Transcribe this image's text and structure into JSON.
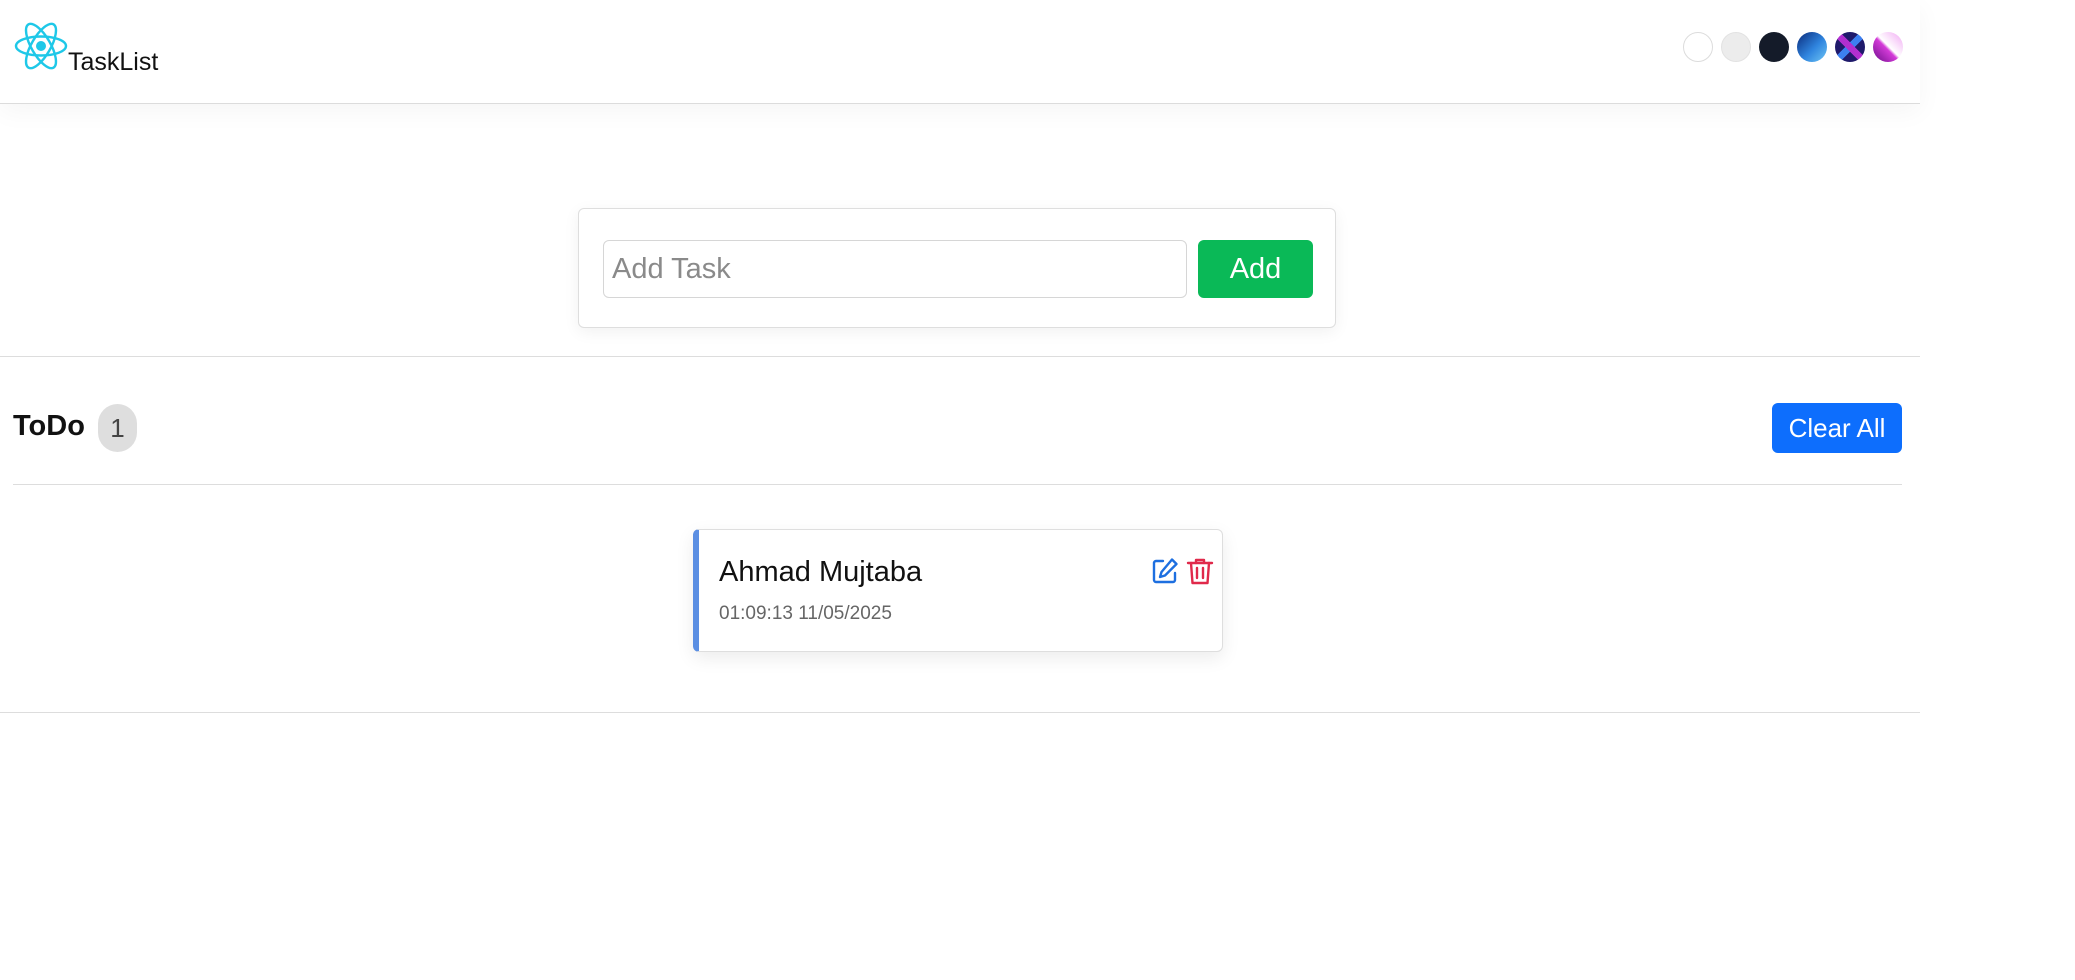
{
  "header": {
    "brand": "TaskList",
    "logo_icon": "react-atom-icon",
    "logo_color": "#1ec8e8",
    "theme_swatches": [
      {
        "name": "theme-swatch-white",
        "color": "#ffffff"
      },
      {
        "name": "theme-swatch-light",
        "color": "#ececec"
      },
      {
        "name": "theme-swatch-dark",
        "color": "#141b29"
      },
      {
        "name": "theme-swatch-blue",
        "color": "#2f84de"
      },
      {
        "name": "theme-swatch-x",
        "color": "#1f1a6b"
      },
      {
        "name": "theme-swatch-gradient",
        "color": "#d43ad8"
      }
    ]
  },
  "form": {
    "placeholder": "Add Task",
    "value": "",
    "add_label": "Add",
    "add_color": "#0ab957"
  },
  "section": {
    "title": "ToDo",
    "count": "1",
    "clear_label": "Clear All",
    "clear_color": "#0d6efd"
  },
  "tasks": [
    {
      "title": "Ahmad Mujtaba",
      "timestamp": "01:09:13 11/05/2025",
      "accent": "#5b8fe3",
      "edit_icon": "edit-icon",
      "delete_icon": "trash-icon"
    }
  ]
}
